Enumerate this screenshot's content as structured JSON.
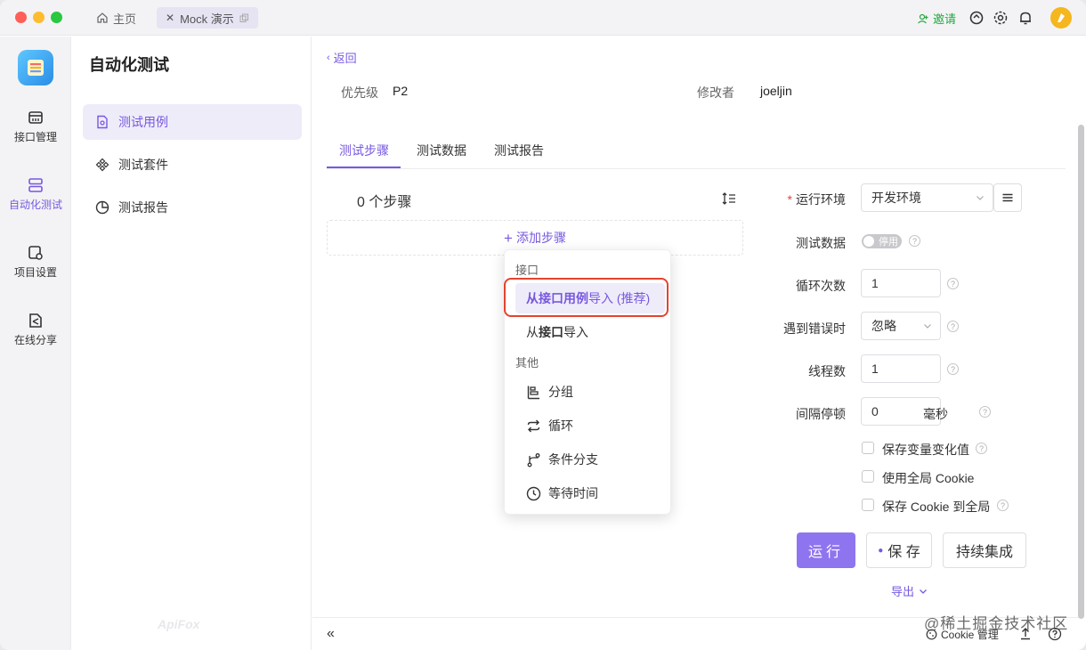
{
  "titlebar": {
    "home_tab": "主页",
    "active_tab": "Mock 演示",
    "invite": "邀请"
  },
  "rail": {
    "items": [
      {
        "label": "接口管理"
      },
      {
        "label": "自动化测试"
      },
      {
        "label": "项目设置"
      },
      {
        "label": "在线分享"
      }
    ]
  },
  "sidebar": {
    "title": "自动化测试",
    "items": [
      {
        "label": "测试用例"
      },
      {
        "label": "测试套件"
      },
      {
        "label": "测试报告"
      }
    ],
    "watermark": "ApiFox"
  },
  "main": {
    "back": "返回",
    "priority_label": "优先级",
    "priority_value": "P2",
    "modifier_label": "修改者",
    "modifier_value": "joeljin",
    "tabs": [
      {
        "label": "测试步骤"
      },
      {
        "label": "测试数据"
      },
      {
        "label": "测试报告"
      }
    ],
    "steps_count": "0 个步骤",
    "add_step": "添加步骤"
  },
  "popup": {
    "group_api": "接口",
    "import_case_bold": "从接口用例",
    "import_case_rest": "导入 (推荐)",
    "import_api_pre": "从",
    "import_api_bold": "接口",
    "import_api_rest": "导入",
    "group_other": "其他",
    "items": [
      {
        "label": "分组",
        "icon": "group-icon"
      },
      {
        "label": "循环",
        "icon": "loop-icon"
      },
      {
        "label": "条件分支",
        "icon": "branch-icon"
      },
      {
        "label": "等待时间",
        "icon": "clock-icon"
      }
    ]
  },
  "form": {
    "env_label": "运行环境",
    "env_value": "开发环境",
    "test_data_label": "测试数据",
    "test_data_toggle": "停用",
    "loop_label": "循环次数",
    "loop_value": "1",
    "on_error_label": "遇到错误时",
    "on_error_value": "忽略",
    "threads_label": "线程数",
    "threads_value": "1",
    "interval_label": "间隔停顿",
    "interval_value": "0",
    "interval_unit": "毫秒",
    "checkboxes": [
      {
        "label": "保存变量变化值",
        "checked": false
      },
      {
        "label": "使用全局 Cookie",
        "checked": false
      },
      {
        "label": "保存 Cookie 到全局",
        "checked": false
      }
    ],
    "run": "运行",
    "save": "保 存",
    "ci": "持续集成",
    "export": "导出"
  },
  "bottombar": {
    "cookie": "Cookie 管理"
  },
  "watermark": "@稀土掘金技术社区",
  "colors": {
    "accent": "#7758e0",
    "run_button": "#8f74f0",
    "highlight_box": "#e5432f",
    "invite": "#23a840"
  }
}
